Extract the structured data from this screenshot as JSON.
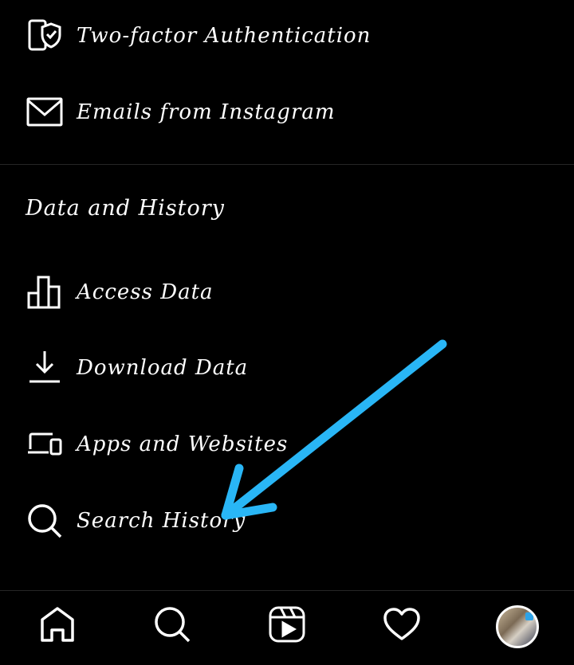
{
  "security": {
    "items": [
      {
        "label": "Two-factor Authentication",
        "icon": "shield-check-phone-icon"
      },
      {
        "label": "Emails from Instagram",
        "icon": "mail-icon"
      }
    ]
  },
  "data_history": {
    "title": "Data and History",
    "items": [
      {
        "label": "Access Data",
        "icon": "bar-chart-icon"
      },
      {
        "label": "Download Data",
        "icon": "download-icon"
      },
      {
        "label": "Apps and Websites",
        "icon": "devices-icon"
      },
      {
        "label": "Search History",
        "icon": "search-icon"
      }
    ]
  },
  "bottom_nav": {
    "items": [
      "home-icon",
      "search-icon",
      "reels-icon",
      "heart-icon",
      "profile-avatar"
    ]
  },
  "annotation": {
    "arrow_color": "#29b6f6",
    "points_to": "Search History"
  }
}
